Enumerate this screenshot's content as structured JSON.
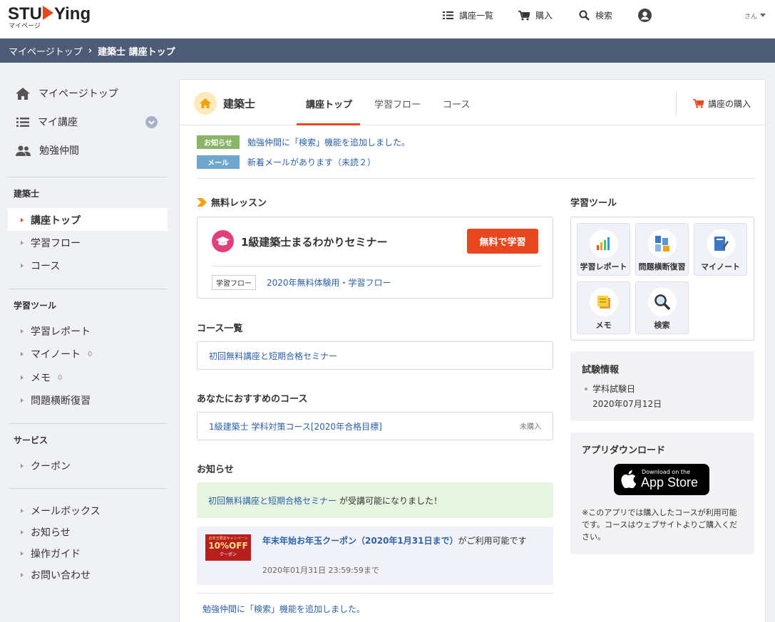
{
  "header": {
    "logo_text": "STU",
    "logo_text2": "Ying",
    "logo_sub": "マイページ",
    "nav": [
      {
        "label": "講座一覧",
        "icon": "list-icon"
      },
      {
        "label": "購入",
        "icon": "cart-icon"
      },
      {
        "label": "検索",
        "icon": "search-icon"
      },
      {
        "label": "",
        "icon": "user-icon"
      }
    ],
    "user_name": "さん"
  },
  "breadcrumb": {
    "items": [
      "マイページトップ",
      "建築士 講座トップ"
    ],
    "separator": "›"
  },
  "sidebar": {
    "main_items": [
      {
        "label": "マイページトップ",
        "icon": "home-icon"
      },
      {
        "label": "マイ講座",
        "icon": "list-icon"
      },
      {
        "label": "勉強仲間",
        "icon": "people-icon"
      }
    ],
    "section1": {
      "heading": "建築士",
      "items": [
        "講座トップ",
        "学習フロー",
        "コース"
      ]
    },
    "section2": {
      "heading": "学習ツール",
      "items": [
        {
          "label": "学習レポート",
          "count": ""
        },
        {
          "label": "マイノート",
          "count": "0"
        },
        {
          "label": "メモ",
          "count": "0"
        },
        {
          "label": "問題横断復習",
          "count": ""
        }
      ]
    },
    "section3": {
      "heading": "サービス",
      "items": [
        "クーポン"
      ]
    },
    "section4": {
      "items": [
        "メールボックス",
        "お知らせ",
        "操作ガイド",
        "お問い合わせ"
      ]
    }
  },
  "main": {
    "category_title": "建築士",
    "tabs": [
      "講座トップ",
      "学習フロー",
      "コース"
    ],
    "buy_label": "講座の購入",
    "notices": [
      {
        "badge": "お知らせ",
        "badge_color": "#8ab46a",
        "text": "勉強仲間に「検索」機能を追加しました。"
      },
      {
        "badge": "メール",
        "badge_color": "#6fa6cc",
        "text": "新着メールがあります（未読２）"
      }
    ],
    "free_lesson": {
      "title": "無料レッスン",
      "seminar": "1級建築士まるわかりセミナー",
      "button": "無料で学習",
      "flow_tag": "学習フロー",
      "flow_link": "2020年無料体験用・学習フロー"
    },
    "course_list": {
      "title": "コース一覧",
      "items": [
        "初回無料講座と短期合格セミナー"
      ]
    },
    "recommended": {
      "title": "あなたにおすすめのコース",
      "items": [
        {
          "label": "1級建築士 学科対策コース[2020年合格目標]",
          "status": "未購入"
        }
      ]
    },
    "news": {
      "title": "お知らせ",
      "green_link": "初回無料講座と短期合格セミナー",
      "green_text": "が受講可能になりました！",
      "coupon_img_line1": "お年玉限定キャンペーン",
      "coupon_img_line2": "10%OFF",
      "coupon_img_line3": "クーポン",
      "coupon_link": "年末年始お年玉クーポン（2020年1月31日まで）",
      "coupon_text": "がご利用可能です",
      "coupon_date": "2020年01月31日 23:59:59まで",
      "last_link": "勉強仲間に「検索」機能を追加しました。"
    },
    "tools": {
      "title": "学習ツール",
      "items": [
        {
          "label": "学習レポート",
          "icon": "chart-icon"
        },
        {
          "label": "問題横断復習",
          "icon": "review-icon"
        },
        {
          "label": "マイノート",
          "icon": "notebook-icon"
        },
        {
          "label": "メモ",
          "icon": "memo-icon"
        },
        {
          "label": "検索",
          "icon": "search-icon"
        }
      ]
    },
    "exam": {
      "title": "試験情報",
      "item": "学科試験日",
      "date": "2020年07月12日"
    },
    "app": {
      "title": "アプリダウンロード",
      "store_line1": "Download on the",
      "store_line2": "App Store",
      "note": "※このアプリでは購入したコースが利用可能です。コースはウェブサイトよりご購入ください。"
    }
  },
  "colors": {
    "accent": "#e8471d",
    "header_bar": "#4d5b77",
    "link": "#2d62a8"
  }
}
